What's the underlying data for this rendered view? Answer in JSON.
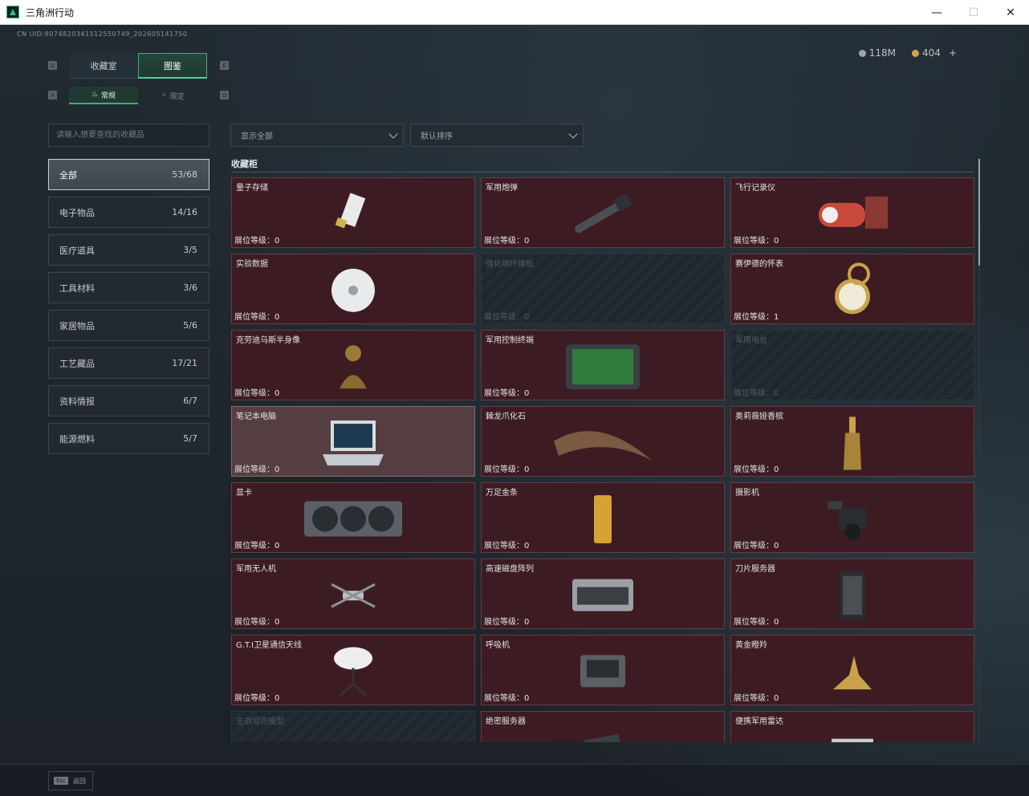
{
  "window": {
    "title": "三角洲行动",
    "minimize": "—",
    "maximize": "☐",
    "close": "✕"
  },
  "uid": "CN UID:9074820341512550749_202605141750",
  "currency": {
    "silver": "118M",
    "gold": "404",
    "plus": "+"
  },
  "tabs": [
    {
      "label": "收藏室",
      "active": false
    },
    {
      "label": "图鉴",
      "active": true
    }
  ],
  "tab_hints": {
    "left": "Q",
    "right": "E",
    "sub_left": "A",
    "sub_right": "D"
  },
  "subtabs": [
    {
      "label": "常规",
      "active": true
    },
    {
      "label": "限定",
      "active": false
    }
  ],
  "search": {
    "placeholder": "请输入想要查找的收藏品"
  },
  "categories": [
    {
      "label": "全部",
      "count": "53/68",
      "active": true
    },
    {
      "label": "电子物品",
      "count": "14/16"
    },
    {
      "label": "医疗道具",
      "count": "3/5"
    },
    {
      "label": "工具材料",
      "count": "3/6"
    },
    {
      "label": "家居物品",
      "count": "5/6"
    },
    {
      "label": "工艺藏品",
      "count": "17/21"
    },
    {
      "label": "资料情报",
      "count": "6/7"
    },
    {
      "label": "能源燃料",
      "count": "5/7"
    }
  ],
  "filters": {
    "display": "显示全部",
    "sort": "默认排序"
  },
  "section_title": "收藏柜",
  "level_prefix": "展位等级：",
  "items": [
    {
      "name": "量子存储",
      "level": "0",
      "icon": "usb-drive-icon",
      "state": "normal"
    },
    {
      "name": "军用炮弹",
      "level": "0",
      "icon": "artillery-shell-icon",
      "state": "normal"
    },
    {
      "name": "飞行记录仪",
      "level": "0",
      "icon": "flight-recorder-icon",
      "state": "normal"
    },
    {
      "name": "实验数据",
      "level": "0",
      "icon": "disc-icon",
      "state": "normal"
    },
    {
      "name": "强化碳纤维板",
      "level": "0",
      "icon": "carbon-plate-icon",
      "state": "locked"
    },
    {
      "name": "赛伊德的怀表",
      "level": "1",
      "icon": "pocket-watch-icon",
      "state": "normal"
    },
    {
      "name": "克劳迪乌斯半身像",
      "level": "0",
      "icon": "bust-icon",
      "state": "normal"
    },
    {
      "name": "军用控制终端",
      "level": "0",
      "icon": "control-terminal-icon",
      "state": "normal"
    },
    {
      "name": "军用电台",
      "level": "0",
      "icon": "radio-icon",
      "state": "locked"
    },
    {
      "name": "笔记本电脑",
      "level": "0",
      "icon": "laptop-icon",
      "state": "highlight"
    },
    {
      "name": "棘龙爪化石",
      "level": "0",
      "icon": "claw-fossil-icon",
      "state": "normal"
    },
    {
      "name": "奥莉薇娅香槟",
      "level": "0",
      "icon": "champagne-icon",
      "state": "normal"
    },
    {
      "name": "显卡",
      "level": "0",
      "icon": "graphics-card-icon",
      "state": "normal"
    },
    {
      "name": "万足金条",
      "level": "0",
      "icon": "gold-bar-icon",
      "state": "normal"
    },
    {
      "name": "摄影机",
      "level": "0",
      "icon": "camera-icon",
      "state": "normal"
    },
    {
      "name": "军用无人机",
      "level": "0",
      "icon": "drone-icon",
      "state": "normal"
    },
    {
      "name": "高速磁盘阵列",
      "level": "0",
      "icon": "disk-array-icon",
      "state": "normal"
    },
    {
      "name": "刀片服务器",
      "level": "0",
      "icon": "blade-server-icon",
      "state": "normal"
    },
    {
      "name": "G.T.I卫星通信天线",
      "level": "0",
      "icon": "satellite-dish-icon",
      "state": "normal"
    },
    {
      "name": "呼吸机",
      "level": "0",
      "icon": "ventilator-icon",
      "state": "normal"
    },
    {
      "name": "黄金瞪羚",
      "level": "0",
      "icon": "golden-gazelle-icon",
      "state": "normal"
    },
    {
      "name": "主战坦克模型",
      "level": "",
      "icon": "tank-model-icon",
      "state": "locked"
    },
    {
      "name": "绝密服务器",
      "level": "",
      "icon": "secret-server-icon",
      "state": "normal"
    },
    {
      "name": "便携军用雷达",
      "level": "",
      "icon": "radar-icon",
      "state": "normal"
    }
  ],
  "footer": {
    "key": "Esc",
    "label": "返回"
  }
}
